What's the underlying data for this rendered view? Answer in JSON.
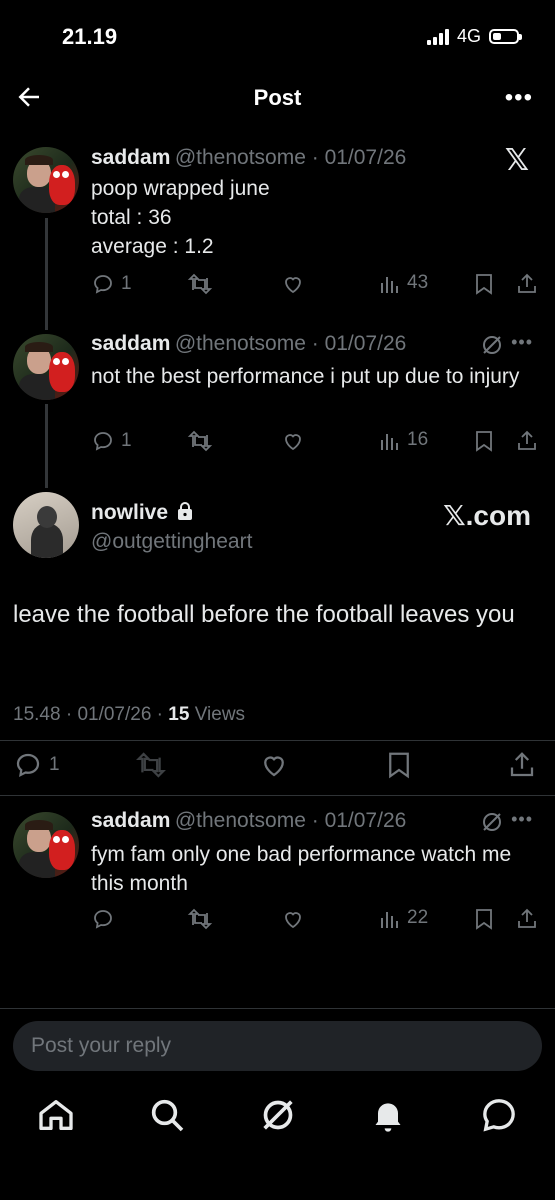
{
  "status": {
    "time": "21.19",
    "network": "4G"
  },
  "header": {
    "title": "Post"
  },
  "tweets": [
    {
      "name": "saddam",
      "handle": "@thenotsome",
      "date": "01/07/26",
      "lines": [
        "poop wrapped june",
        "total : 36",
        "average : 1.2"
      ],
      "replies": "1",
      "views": "43"
    },
    {
      "name": "saddam",
      "handle": "@thenotsome",
      "date": "01/07/26",
      "text": "not the best performance i put up due to injury",
      "replies": "1",
      "views": "16"
    }
  ],
  "main_post": {
    "name": "nowlive",
    "handle": "@outgettingheart",
    "watermark": "𝕏.com",
    "text": "leave the football before the football leaves you",
    "time": "15.48",
    "date": "01/07/26",
    "views_count": "15",
    "views_label": "Views",
    "replies": "1"
  },
  "reply": {
    "name": "saddam",
    "handle": "@thenotsome",
    "date": "01/07/26",
    "text": "fym fam only one bad performance watch me this month",
    "views": "22"
  },
  "compose": {
    "placeholder": "Post your reply"
  },
  "icons": [
    "back-arrow-icon",
    "more-icon",
    "x-logo-icon",
    "reply-icon",
    "repost-icon",
    "like-icon",
    "views-icon",
    "bookmark-icon",
    "share-icon",
    "grok-icon",
    "lock-icon",
    "home-icon",
    "search-icon",
    "notifications-icon",
    "messages-icon"
  ]
}
